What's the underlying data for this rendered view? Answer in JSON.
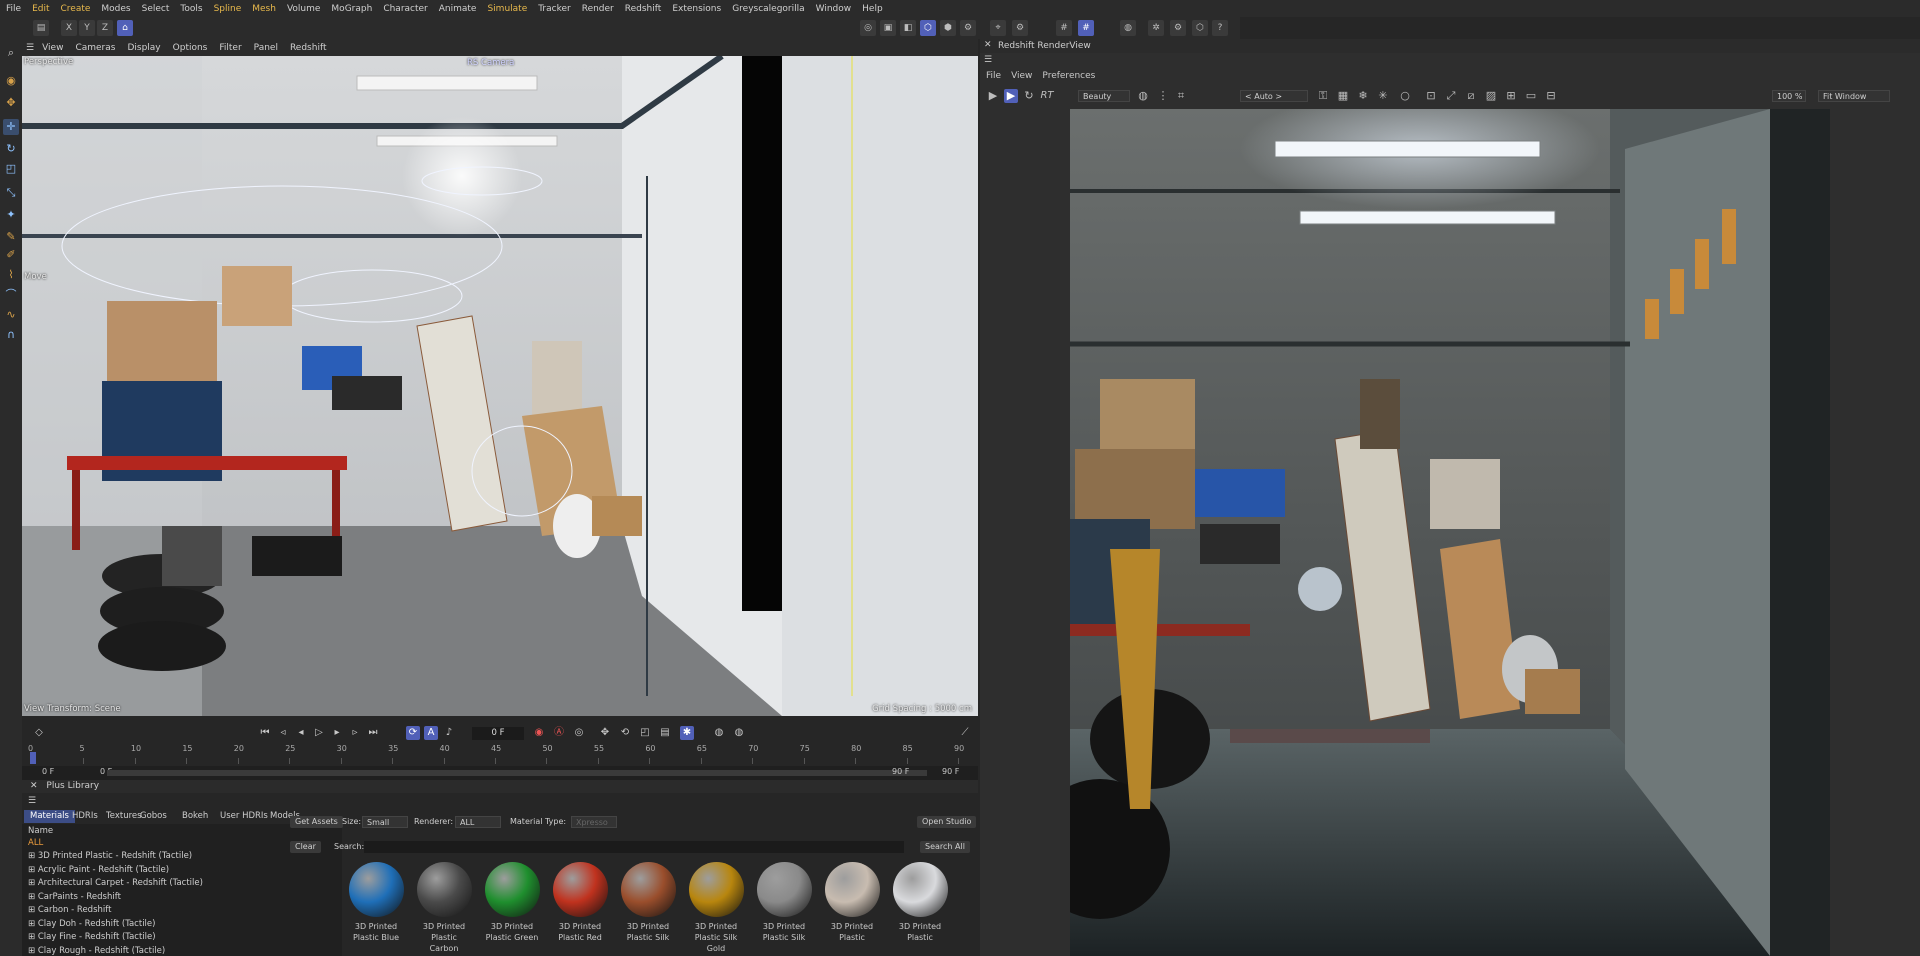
{
  "menubar": {
    "items": [
      "File",
      "Edit",
      "Create",
      "Modes",
      "Select",
      "Tools",
      "Spline",
      "Mesh",
      "Volume",
      "MoGraph",
      "Character",
      "Animate",
      "Simulate",
      "Tracker",
      "Render",
      "Redshift",
      "Extensions",
      "Greyscalegorilla",
      "Window",
      "Help"
    ]
  },
  "toolbar": {
    "axis_x": "X",
    "axis_y": "Y",
    "axis_z": "Z"
  },
  "viewport": {
    "menu": [
      "View",
      "Cameras",
      "Display",
      "Options",
      "Filter",
      "Panel",
      "Redshift"
    ],
    "label": "Perspective",
    "camera_label": "RS Camera",
    "move_label": "Move",
    "view_transform": "View Transform: Scene",
    "grid_spacing": "Grid Spacing : 5000 cm"
  },
  "timeline": {
    "frame_field": "0 F",
    "ticks": [
      "0",
      "5",
      "10",
      "15",
      "20",
      "25",
      "30",
      "35",
      "40",
      "45",
      "50",
      "55",
      "60",
      "65",
      "70",
      "75",
      "80",
      "85",
      "90"
    ],
    "start_a": "0 F",
    "start_b": "0 F",
    "end_a": "90 F",
    "end_b": "90 F"
  },
  "library": {
    "title": "Plus Library",
    "tabs": [
      "Materials",
      "HDRIs",
      "Textures",
      "Gobos",
      "Bokeh",
      "User HDRIs",
      "Models"
    ],
    "tree_header": "Name",
    "tree_all": "ALL",
    "tree_items": [
      "3D Printed Plastic - Redshift (Tactile)",
      "Acrylic Paint - Redshift (Tactile)",
      "Architectural Carpet - Redshift (Tactile)",
      "CarPaints - Redshift",
      "Carbon - Redshift",
      "Clay Doh - Redshift (Tactile)",
      "Clay Fine - Redshift (Tactile)",
      "Clay Rough - Redshift (Tactile)"
    ],
    "get_assets": "Get Assets",
    "size_label": "Size:",
    "size_value": "Small",
    "renderer_label": "Renderer:",
    "renderer_value": "ALL",
    "material_type_label": "Material Type:",
    "material_type_value": "Xpresso",
    "open_studio": "Open Studio",
    "clear": "Clear",
    "search_label": "Search:",
    "search_all": "Search All",
    "swatches": [
      {
        "line1": "3D Printed",
        "line2": "Plastic Blue",
        "color": "#1f6fb8"
      },
      {
        "line1": "3D Printed",
        "line2": "Plastic Carbon",
        "color": "#4a4a4a"
      },
      {
        "line1": "3D Printed",
        "line2": "Plastic Green",
        "color": "#1f8f2e"
      },
      {
        "line1": "3D Printed",
        "line2": "Plastic Red",
        "color": "#c0321e"
      },
      {
        "line1": "3D Printed",
        "line2": "Plastic Silk",
        "color": "#9a4e2c"
      },
      {
        "line1": "3D Printed",
        "line2": "Plastic Silk Gold",
        "color": "#b8860e"
      },
      {
        "line1": "3D Printed",
        "line2": "Plastic Silk",
        "color": "#8a8a8a"
      },
      {
        "line1": "3D Printed",
        "line2": "Plastic",
        "color": "#c8bcb0"
      },
      {
        "line1": "3D Printed",
        "line2": "Plastic",
        "color": "#d9dadd"
      }
    ]
  },
  "renderview": {
    "title": "Redshift RenderView",
    "menu": [
      "File",
      "View",
      "Preferences"
    ],
    "rt_label": "RT",
    "aov_value": "Beauty",
    "camera_value": "< Auto >",
    "zoom_value": "100 %",
    "fit_value": "Fit Window"
  },
  "colors": {
    "accent": "#5160b8",
    "highlight_menu": "#e8b94c"
  }
}
